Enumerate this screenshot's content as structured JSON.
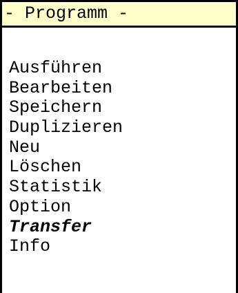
{
  "menu": {
    "title": "- Programm -",
    "items": [
      {
        "label": "Ausführen"
      },
      {
        "label": "Bearbeiten"
      },
      {
        "label": "Speichern"
      },
      {
        "label": "Duplizieren"
      },
      {
        "label": "Neu"
      },
      {
        "label": "Löschen"
      },
      {
        "label": "Statistik"
      },
      {
        "label": "Option"
      },
      {
        "label": "Transfer",
        "selected": true
      },
      {
        "label": "Info"
      }
    ]
  },
  "colors": {
    "header_background": "#ffffcc",
    "border": "#000000",
    "text": "#000000",
    "background": "#ffffff"
  }
}
